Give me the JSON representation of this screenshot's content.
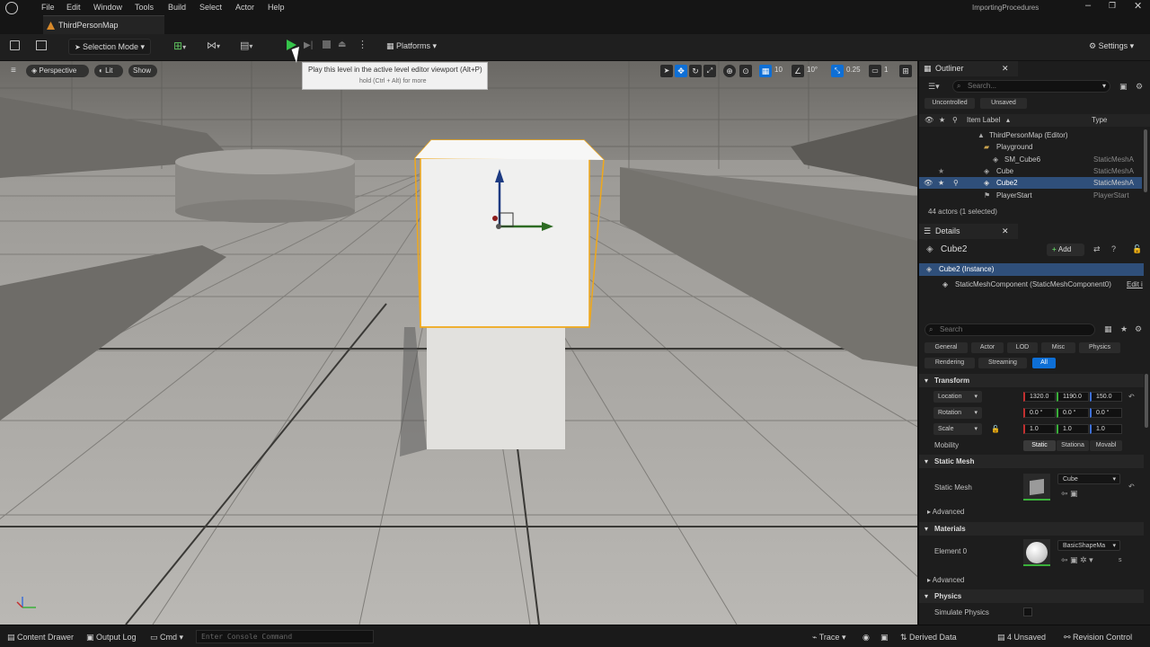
{
  "menu": [
    "File",
    "Edit",
    "Window",
    "Tools",
    "Build",
    "Select",
    "Actor",
    "Help"
  ],
  "project_name": "ImportingProcedures",
  "map_tab": "ThirdPersonMap",
  "toolbar": {
    "selection_mode": "Selection Mode",
    "platforms": "Platforms",
    "settings": "Settings"
  },
  "viewport": {
    "perspective": "Perspective",
    "lit": "Lit",
    "show": "Show",
    "grid_snap": "10",
    "rot_snap": "10°",
    "scale_snap": "0.25",
    "camera_speed": "1"
  },
  "tooltip": {
    "main": "Play this level in the active level editor viewport (Alt+P)",
    "sub": "hold (Ctrl + Alt) for more"
  },
  "outliner": {
    "title": "Outliner",
    "search_placeholder": "Search...",
    "filter_uncontrolled": "Uncontrolled",
    "filter_unsaved": "Unsaved",
    "col_label": "Item Label",
    "col_type": "Type",
    "items": [
      {
        "label": "ThirdPersonMap (Editor)",
        "type": ""
      },
      {
        "label": "Playground",
        "type": ""
      },
      {
        "label": "SM_Cube6",
        "type": "StaticMeshA"
      },
      {
        "label": "Cube",
        "type": "StaticMeshA"
      },
      {
        "label": "Cube2",
        "type": "StaticMeshA"
      },
      {
        "label": "PlayerStart",
        "type": "PlayerStart"
      }
    ],
    "count": "44 actors (1 selected)"
  },
  "details": {
    "title": "Details",
    "actor_name": "Cube2",
    "add_label": "Add",
    "instance": "Cube2 (Instance)",
    "component": "StaticMeshComponent (StaticMeshComponent0)",
    "edit_link": "Edit i",
    "search_placeholder": "Search",
    "tabs": [
      "General",
      "Actor",
      "LOD",
      "Misc",
      "Physics",
      "Rendering",
      "Streaming",
      "All"
    ],
    "transform_header": "Transform",
    "location_label": "Location",
    "location": [
      "1320.0",
      "1190.0",
      "150.0"
    ],
    "rotation_label": "Rotation",
    "rotation": [
      "0.0 °",
      "0.0 °",
      "0.0 °"
    ],
    "scale_label": "Scale",
    "scale": [
      "1.0",
      "1.0",
      "1.0"
    ],
    "mobility_label": "Mobility",
    "mobility_options": [
      "Static",
      "Stationa",
      "Movabl"
    ],
    "static_mesh_header": "Static Mesh",
    "static_mesh_label": "Static Mesh",
    "static_mesh_value": "Cube",
    "advanced": "Advanced",
    "materials_header": "Materials",
    "element0_label": "Element 0",
    "element0_value": "BasicShapeMa",
    "element0_suffix": "s",
    "advanced2": "Advanced",
    "physics_header": "Physics",
    "simulate_physics": "Simulate Physics"
  },
  "statusbar": {
    "content_drawer": "Content Drawer",
    "output_log": "Output Log",
    "cmd": "Cmd",
    "console_placeholder": "Enter Console Command",
    "trace": "Trace",
    "derived_data": "Derived Data",
    "unsaved": "4 Unsaved",
    "revision_control": "Revision Control"
  },
  "colors": {
    "accent_blue": "#0e6fd6",
    "play_green": "#35c44a",
    "selection_outline": "#f0a81a",
    "selection_row": "#2f4f7a"
  }
}
